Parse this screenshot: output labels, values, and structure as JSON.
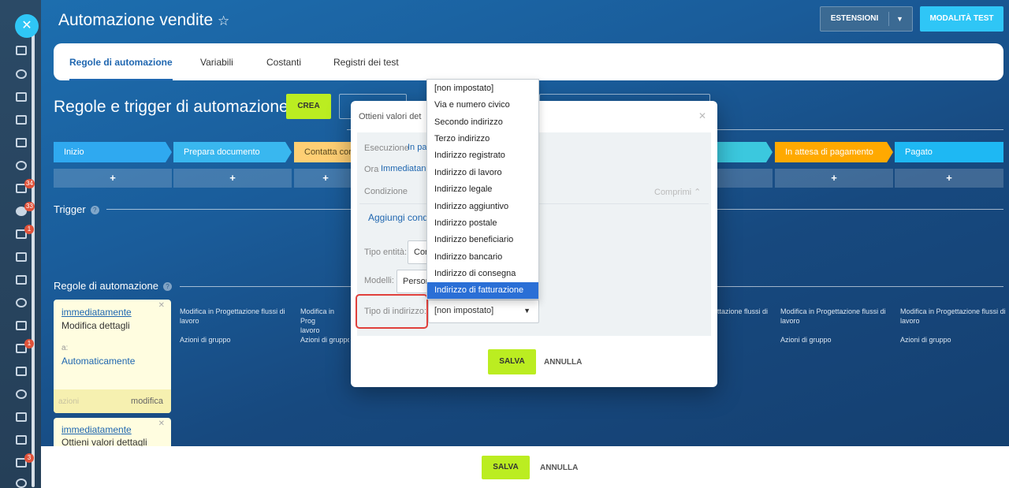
{
  "app": {
    "title": "Automazione vendite",
    "star_icon": "star-outline-icon"
  },
  "header": {
    "extensions_label": "ESTENSIONI",
    "test_mode_label": "MODALITÀ TEST"
  },
  "tabs": [
    "Regole di automazione",
    "Variabili",
    "Costanti",
    "Registri dei test"
  ],
  "section_title": "Regole e trigger di automazione",
  "create_label": "CREA",
  "stages": [
    {
      "label": "Inizio",
      "color": "#2fa9f0"
    },
    {
      "label": "Prepara documento",
      "color": "#39b7ef"
    },
    {
      "label": "Contatta cor",
      "color": "#ffcf74"
    },
    {
      "label": "",
      "color": "#3bc8de"
    },
    {
      "label": "In attesa di pagamento",
      "color": "#ffa900"
    },
    {
      "label": "Pagato",
      "color": "#1eb8f3"
    }
  ],
  "plus": "+",
  "trigger_label": "Trigger",
  "rules_label": "Regole di automazione",
  "cards": [
    {
      "when": "immediatamente",
      "title": "Modifica dettagli",
      "to_label": "a:",
      "to_value": "Automaticamente",
      "actions": "azioni",
      "edit": "modifica"
    },
    {
      "when": "immediatamente",
      "title": "Ottieni valori dettagli"
    }
  ],
  "column_texts": {
    "modify": "Modifica in Progettazione flussi di lavoro",
    "modify_clip": "Modifica in Prog",
    "modify_tail": "ttazione flussi di",
    "group": "Azioni di gruppo",
    "group_clip": "Azioni di gruppo",
    "lavoro": "lavoro"
  },
  "modal": {
    "title": "Ottieni valori det",
    "exec_label": "Esecuzione",
    "exec_value": "In pa",
    "time_label": "Ora",
    "time_value": "Immediatan",
    "cond_label": "Condizione",
    "collapse": "Comprimi",
    "add_cond": "Aggiungi condi",
    "entity_label": "Tipo entità:",
    "entity_value": "Con",
    "models_label": "Modelli:",
    "models_value": "Person",
    "address_label": "Tipo di indirizzo:",
    "address_value": "[non impostato]",
    "save": "SALVA",
    "cancel": "ANNULLA"
  },
  "dropdown": {
    "options": [
      "[non impostato]",
      "Via e numero civico",
      "Secondo indirizzo",
      "Terzo indirizzo",
      "Indirizzo registrato",
      "Indirizzo di lavoro",
      "Indirizzo legale",
      "Indirizzo aggiuntivo",
      "Indirizzo postale",
      "Indirizzo beneficiario",
      "Indirizzo bancario",
      "Indirizzo di consegna",
      "Indirizzo di fatturazione"
    ],
    "selected": "Indirizzo di fatturazione"
  },
  "footer": {
    "save": "SALVA",
    "cancel": "ANNULLA"
  },
  "sidebar_badges": [
    "34",
    "33",
    "1",
    "1",
    "3"
  ]
}
